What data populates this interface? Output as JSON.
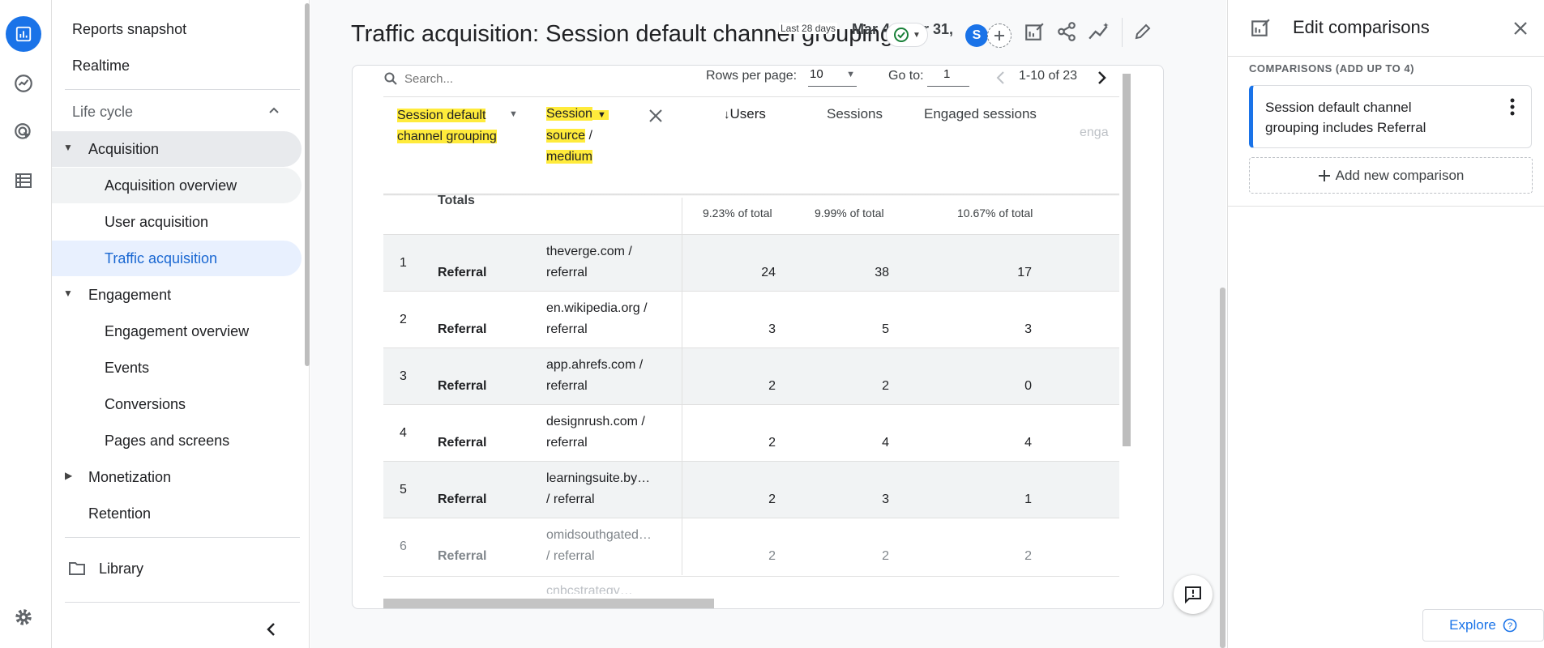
{
  "header": {
    "title": "Traffic acquisition: Session default channel grouping",
    "date_label": "Last 28 days",
    "date_range": "Mar 4 - Mar 31, 2023",
    "avatar_letter": "S"
  },
  "sidebar": {
    "items": [
      {
        "label": "Reports snapshot"
      },
      {
        "label": "Realtime"
      },
      {
        "label": "Life cycle"
      },
      {
        "label": "Acquisition"
      },
      {
        "label": "Acquisition overview"
      },
      {
        "label": "User acquisition"
      },
      {
        "label": "Traffic acquisition"
      },
      {
        "label": "Engagement"
      },
      {
        "label": "Engagement overview"
      },
      {
        "label": "Events"
      },
      {
        "label": "Conversions"
      },
      {
        "label": "Pages and screens"
      },
      {
        "label": "Monetization"
      },
      {
        "label": "Retention"
      },
      {
        "label": "Library"
      }
    ]
  },
  "table": {
    "search_placeholder": "Search...",
    "rows_per_page_label": "Rows per page:",
    "rows_per_page_value": "10",
    "goto_label": "Go to:",
    "goto_value": "1",
    "pagination": "1-10 of 23",
    "col_dim1_l1": "Session default",
    "col_dim1_l2": "channel grouping",
    "col_dim2_l1": "Session",
    "col_dim2_l2": "source",
    "col_dim2_l2b": " /",
    "col_dim2_l3": "medium",
    "col_users": "Users",
    "col_sessions": "Sessions",
    "col_engaged": "Engaged sessions",
    "col_cut": "enga",
    "totals_label": "Totals",
    "totals_users": "9.23% of total",
    "totals_sessions": "9.99% of total",
    "totals_engaged": "10.67% of total",
    "rows": [
      {
        "num": "1",
        "channel": "Referral",
        "src1": "theverge.com /",
        "src2": "referral",
        "users": "24",
        "sessions": "38",
        "engaged": "17"
      },
      {
        "num": "2",
        "channel": "Referral",
        "src1": "en.wikipedia.org /",
        "src2": "referral",
        "users": "3",
        "sessions": "5",
        "engaged": "3"
      },
      {
        "num": "3",
        "channel": "Referral",
        "src1": "app.ahrefs.com /",
        "src2": "referral",
        "users": "2",
        "sessions": "2",
        "engaged": "0"
      },
      {
        "num": "4",
        "channel": "Referral",
        "src1": "designrush.com /",
        "src2": "referral",
        "users": "2",
        "sessions": "4",
        "engaged": "4"
      },
      {
        "num": "5",
        "channel": "Referral",
        "src1": "learningsuite.by…",
        "src2": "/ referral",
        "users": "2",
        "sessions": "3",
        "engaged": "1"
      },
      {
        "num": "6",
        "channel": "Referral",
        "src1": "omidsouthgated…",
        "src2": "/ referral",
        "users": "2",
        "sessions": "2",
        "engaged": "2"
      }
    ],
    "row7_partial": "cnbcstrategy…"
  },
  "comparisons": {
    "panel_title": "Edit comparisons",
    "section_label": "COMPARISONS (ADD UP TO 4)",
    "item_l1": "Session default channel",
    "item_l2": "grouping includes Referral",
    "add_label": "Add new comparison"
  },
  "explore_label": "Explore",
  "colors": {
    "accent": "#1a73e8",
    "highlight": "#ffeb3b",
    "nav_selected": "#e8f0fe"
  },
  "icons": [
    "home-icon",
    "reports-icon",
    "explore-icon",
    "advertising-icon",
    "configure-icon",
    "gear-icon",
    "collapse-icon",
    "folder-icon",
    "search-icon",
    "close-icon",
    "share-icon",
    "insights-icon",
    "edit-icon",
    "feedback-icon",
    "help-icon",
    "more-vert-icon"
  ]
}
